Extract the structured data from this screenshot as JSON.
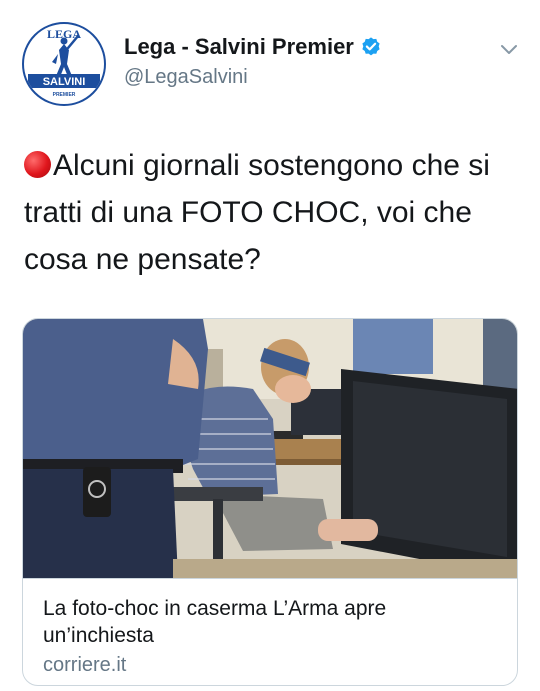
{
  "author": {
    "display_name": "Lega - Salvini Premier",
    "handle": "@LegaSalvini",
    "avatar_text_top": "LEGA",
    "avatar_text_band": "SALVINI",
    "avatar_text_sub": "PREMIER"
  },
  "tweet": {
    "text": "Alcuni giornali sostengono che si tratti di una FOTO CHOC, voi che cosa ne pensate?"
  },
  "card": {
    "title": "La foto-choc in caserma L’Arma apre un’inchiesta",
    "domain": "corriere.it"
  },
  "colors": {
    "verified": "#1da1f2",
    "handle": "#657786",
    "text": "#14171a",
    "red_dot": "#e0161d"
  },
  "icons": {
    "verified": "verified-badge-icon",
    "menu": "chevron-down-icon",
    "emoji": "red-circle-icon"
  }
}
